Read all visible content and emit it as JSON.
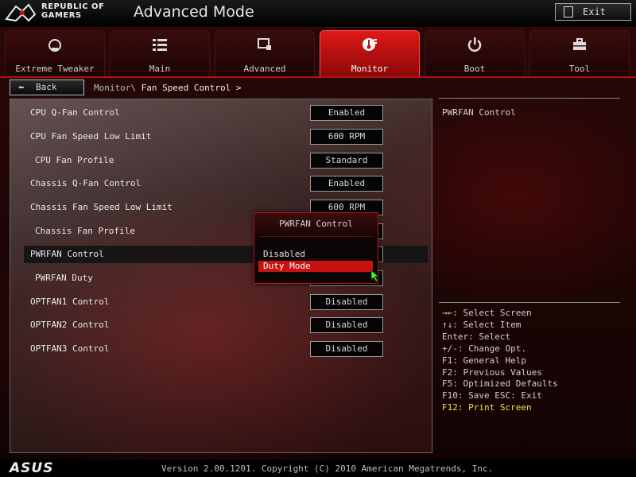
{
  "header": {
    "brand_line1": "REPUBLIC OF",
    "brand_line2": "GAMERS",
    "title": "Advanced Mode",
    "exit_label": "Exit"
  },
  "tabs": [
    {
      "label": "Extreme Tweaker",
      "icon": "speedometer-icon"
    },
    {
      "label": "Main",
      "icon": "list-icon"
    },
    {
      "label": "Advanced",
      "icon": "chip-icon"
    },
    {
      "label": "Monitor",
      "icon": "thermometer-fan-icon",
      "active": true
    },
    {
      "label": "Boot",
      "icon": "power-icon"
    },
    {
      "label": "Tool",
      "icon": "toolbox-icon"
    }
  ],
  "breadcrumb": {
    "back_label": "Back",
    "path": "Monitor\\",
    "current": "Fan Speed Control >"
  },
  "settings": [
    {
      "label": "CPU Q-Fan Control",
      "value": "Enabled"
    },
    {
      "label": "CPU Fan Speed Low Limit",
      "value": "600 RPM"
    },
    {
      "label": "CPU Fan Profile",
      "value": "Standard"
    },
    {
      "label": "Chassis Q-Fan Control",
      "value": "Enabled"
    },
    {
      "label": "Chassis Fan Speed Low Limit",
      "value": "600 RPM"
    },
    {
      "label": "Chassis Fan Profile",
      "value": ""
    },
    {
      "label": "PWRFAN Control",
      "value": ""
    },
    {
      "label": "PWRFAN Duty",
      "value": ""
    },
    {
      "label": "OPTFAN1 Control",
      "value": "Disabled"
    },
    {
      "label": "OPTFAN2 Control",
      "value": "Disabled"
    },
    {
      "label": "OPTFAN3 Control",
      "value": "Disabled"
    }
  ],
  "popup": {
    "title": "PWRFAN Control",
    "options": [
      "Disabled",
      "Duty Mode"
    ],
    "selected": "Duty Mode"
  },
  "help_panel": {
    "title": "PWRFAN Control",
    "keys": [
      "→←: Select Screen",
      "↑↓: Select Item",
      "Enter: Select",
      "+/-: Change Opt.",
      "F1: General Help",
      "F2: Previous Values",
      "F5: Optimized Defaults",
      "F10: Save  ESC: Exit",
      "F12: Print Screen"
    ]
  },
  "footer": {
    "brand": "ASUS",
    "version": "Version 2.00.1201. Copyright (C) 2010 American Megatrends, Inc."
  },
  "colors": {
    "accent": "#c81212",
    "highlight_text": "#f2e14c",
    "background": "#120303"
  }
}
